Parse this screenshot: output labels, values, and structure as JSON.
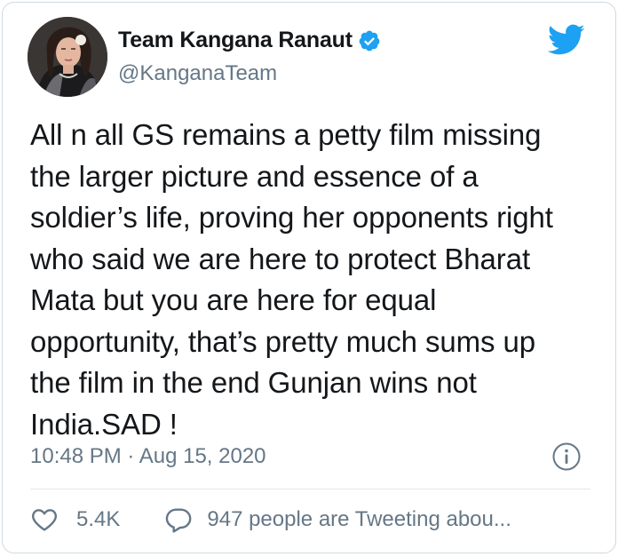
{
  "tweet": {
    "author": {
      "display_name": "Team Kangana Ranaut",
      "handle": "@KanganaTeam",
      "verified": true,
      "avatar_icon": "profile-photo"
    },
    "text": "All n all GS remains a petty film missing\nthe larger picture and essence of a\nsoldier’s life, proving her opponents right\nwho said we are here to protect Bharat\nMata but you are here for equal\nopportunity, that’s pretty much sums up\nthe film in the end Gunjan wins not\nIndia.SAD !",
    "timestamp": "10:48 PM · Aug 15, 2020",
    "likes": {
      "count": "5.4K",
      "icon": "heart-icon"
    },
    "conversation": {
      "label": "947 people are Tweeting abou...",
      "icon": "speech-bubble-icon"
    }
  },
  "icons": {
    "brand": "twitter-bird-icon",
    "verified": "verified-badge-icon",
    "info": "info-icon"
  },
  "colors": {
    "brand_blue": "#1da1f2",
    "text_primary": "#14171a",
    "text_secondary": "#657786",
    "border": "#cfd9de"
  }
}
